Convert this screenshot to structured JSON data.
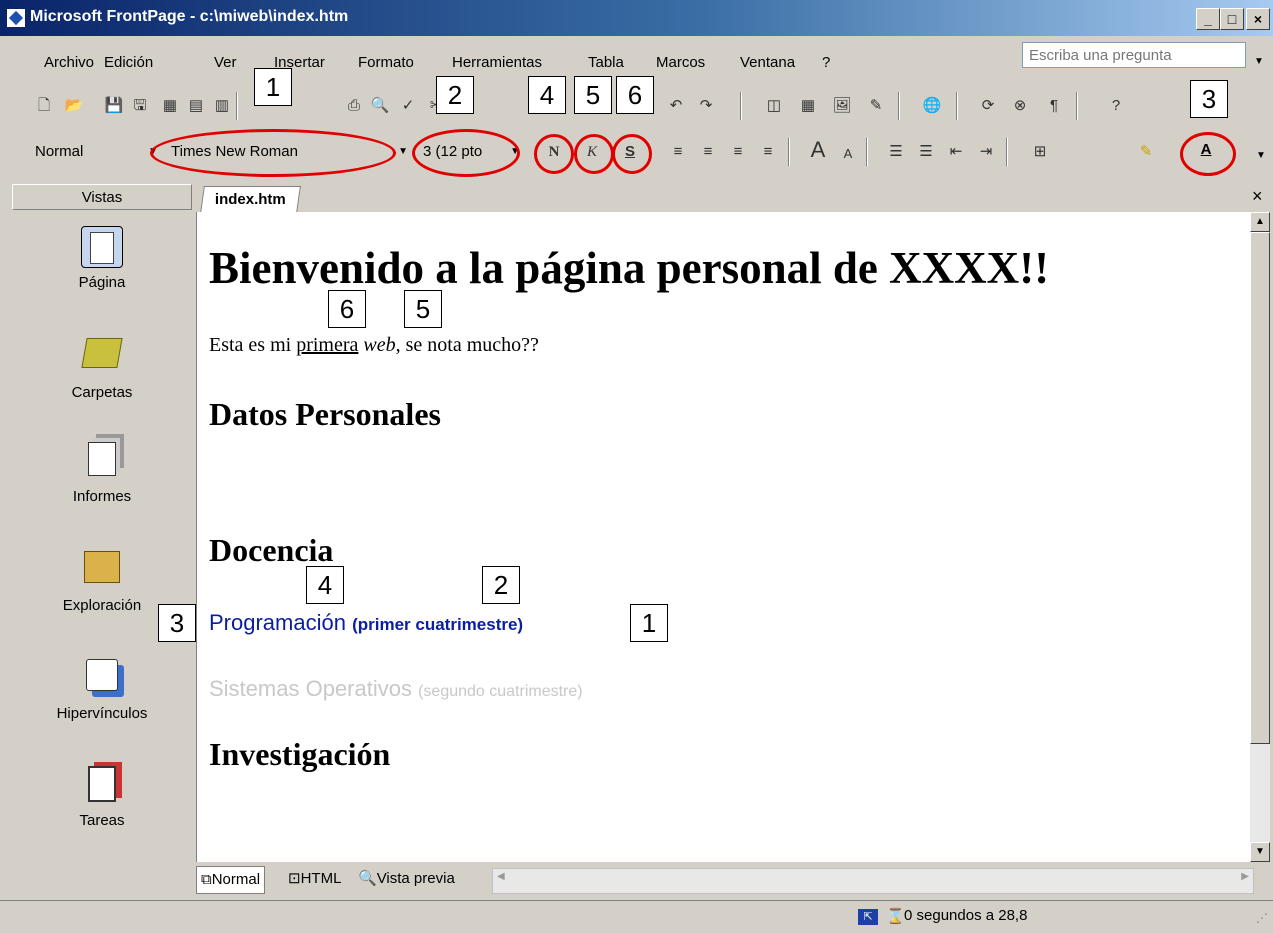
{
  "window": {
    "title": "Microsoft FrontPage - c:\\miweb\\index.htm",
    "min_label": "_",
    "max_label": "□",
    "close_label": "×"
  },
  "menu": {
    "items": [
      "Archivo",
      "Edición",
      "Ver",
      "Insertar",
      "Formato",
      "Herramientas",
      "Tabla",
      "Marcos",
      "Ventana",
      "?"
    ],
    "ask_placeholder": "Escriba una pregunta"
  },
  "format_toolbar": {
    "style": "Normal",
    "font": "Times New Roman",
    "size": "3  (12 pto",
    "bold_label": "N",
    "italic_label": "K",
    "underline_label": "S"
  },
  "callouts": {
    "toolbar_font": "1",
    "toolbar_size": "2",
    "toolbar_bold": "4",
    "toolbar_italic": "5",
    "toolbar_underline": "6",
    "toolbar_color": "3",
    "text_underline": "6",
    "text_italic": "5",
    "text_bold": "4",
    "text_size": "2",
    "text_color": "3",
    "text_font": "1"
  },
  "sidebar": {
    "header": "Vistas",
    "items": [
      {
        "label": "Página",
        "icon": "page-icon"
      },
      {
        "label": "Carpetas",
        "icon": "folder-icon"
      },
      {
        "label": "Informes",
        "icon": "reports-icon"
      },
      {
        "label": "Exploración",
        "icon": "navigation-icon"
      },
      {
        "label": "Hipervínculos",
        "icon": "hyperlinks-icon"
      },
      {
        "label": "Tareas",
        "icon": "tasks-icon"
      }
    ]
  },
  "document": {
    "tab": "index.htm",
    "heading": "Bienvenido a la página personal de XXXX!!",
    "intro_pre": "Esta es mi ",
    "intro_underlined": "primera",
    "intro_space": " ",
    "intro_italic": "web",
    "intro_post": ", se nota mucho??",
    "section1": "Datos Personales",
    "section2": "Docencia",
    "course1_name": "Programación",
    "course1_detail": "(primer cuatrimestre)",
    "course2_name": "Sistemas Operativos",
    "course2_detail": "(segundo cuatrimestre)",
    "section3": "Investigación",
    "colors": {
      "course1": "#0a1f9e",
      "course2": "#c8c8c8"
    }
  },
  "view_tabs": [
    "Normal",
    "HTML",
    "Vista previa"
  ],
  "status": {
    "text": "0 segundos a 28,8"
  }
}
